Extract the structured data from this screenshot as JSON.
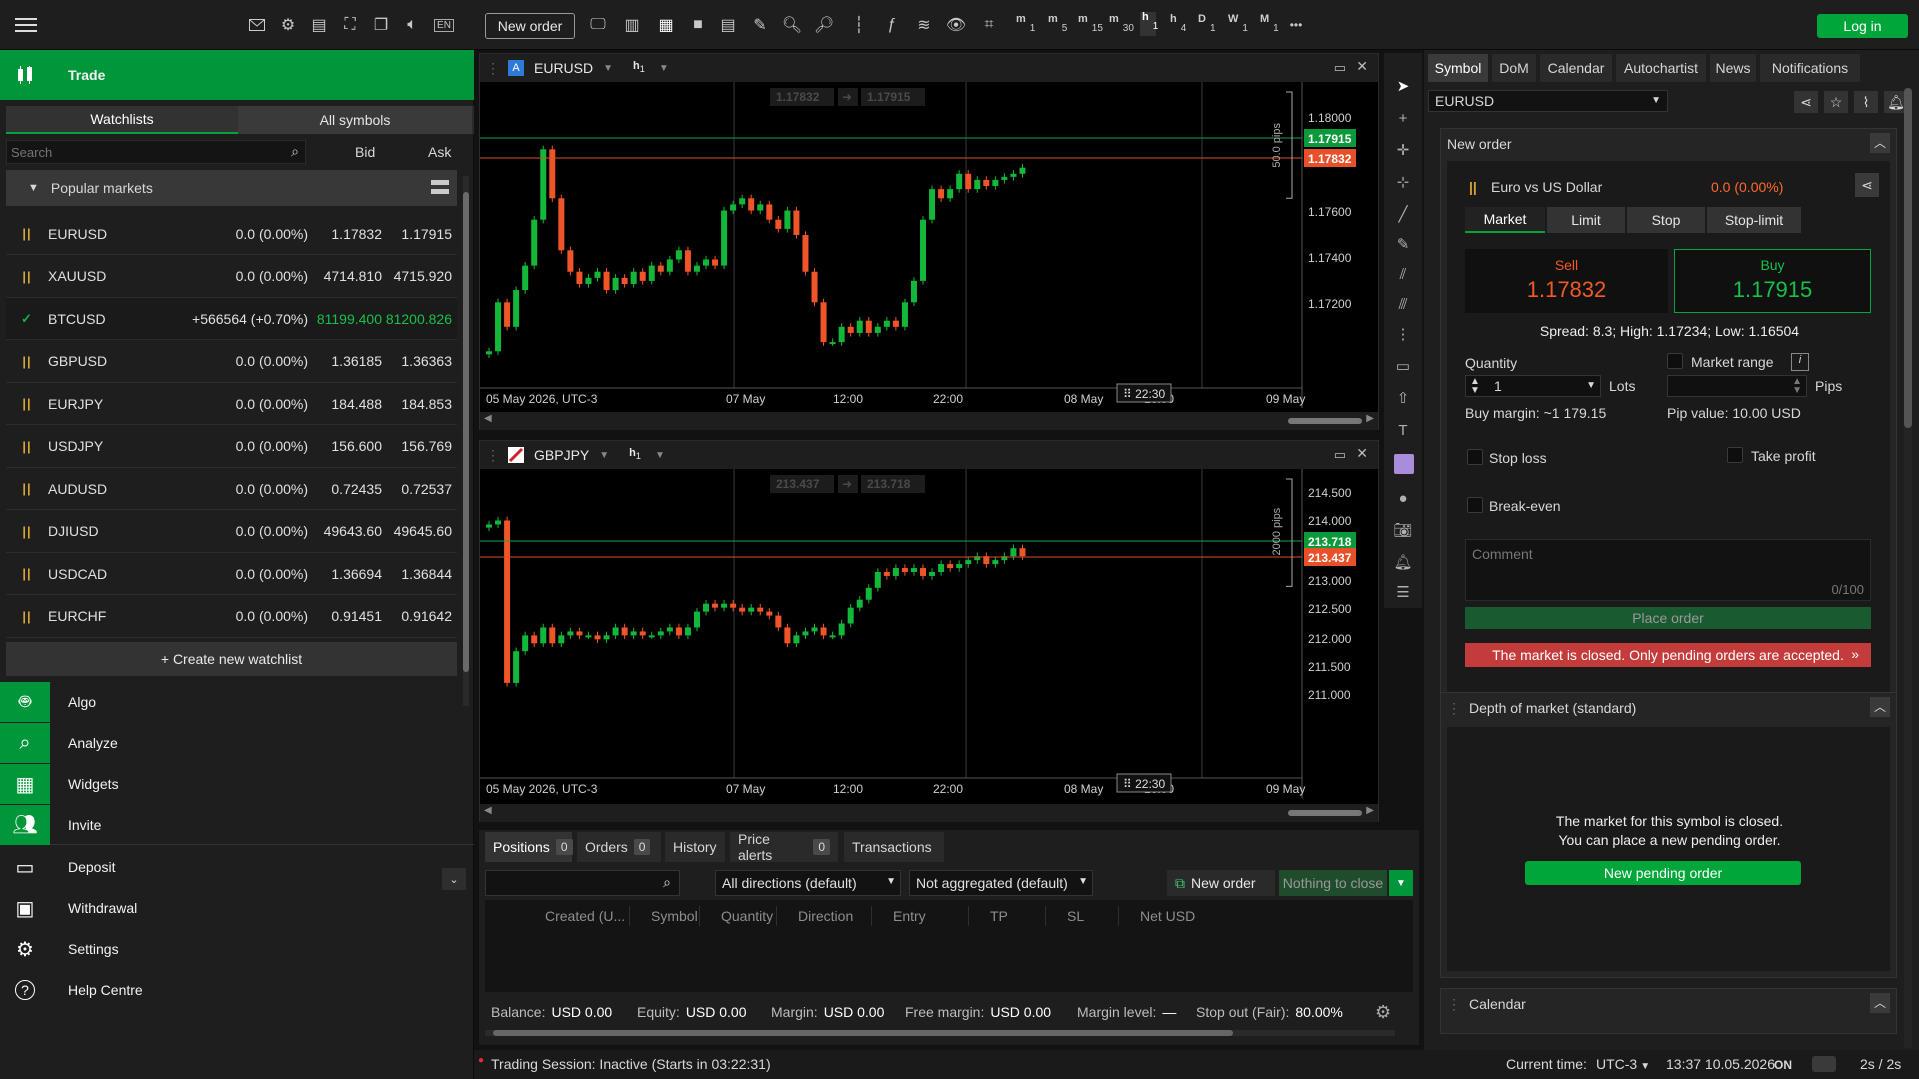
{
  "topbar": {
    "new_order": "New order",
    "login": "Log in",
    "lang": "EN",
    "more": "•••",
    "timeframes": [
      {
        "main": "m",
        "sub": "1"
      },
      {
        "main": "m",
        "sub": "5"
      },
      {
        "main": "m",
        "sub": "15"
      },
      {
        "main": "m",
        "sub": "30"
      },
      {
        "main": "h",
        "sub": "1"
      },
      {
        "main": "h",
        "sub": "4"
      },
      {
        "main": "D",
        "sub": "1"
      },
      {
        "main": "W",
        "sub": "1"
      },
      {
        "main": "M",
        "sub": "1"
      }
    ]
  },
  "sidebar": {
    "trade": "Trade",
    "tabs": [
      "Watchlists",
      "All symbols"
    ],
    "search_placeholder": "Search",
    "col_bid": "Bid",
    "col_ask": "Ask",
    "group": "Popular markets",
    "rows": [
      {
        "sym": "EURUSD",
        "chg": "0.0 (0.00%)",
        "bid": "1.17832",
        "ask": "1.17915",
        "status": "paused"
      },
      {
        "sym": "XAUUSD",
        "chg": "0.0 (0.00%)",
        "bid": "4714.810",
        "ask": "4715.920",
        "status": "paused"
      },
      {
        "sym": "BTCUSD",
        "chg": "+566564 (+0.70%)",
        "bid": "81199.400",
        "ask": "81200.826",
        "status": "open"
      },
      {
        "sym": "GBPUSD",
        "chg": "0.0 (0.00%)",
        "bid": "1.36185",
        "ask": "1.36363",
        "status": "paused"
      },
      {
        "sym": "EURJPY",
        "chg": "0.0 (0.00%)",
        "bid": "184.488",
        "ask": "184.853",
        "status": "paused"
      },
      {
        "sym": "USDJPY",
        "chg": "0.0 (0.00%)",
        "bid": "156.600",
        "ask": "156.769",
        "status": "paused"
      },
      {
        "sym": "AUDUSD",
        "chg": "0.0 (0.00%)",
        "bid": "0.72435",
        "ask": "0.72537",
        "status": "paused"
      },
      {
        "sym": "DJIUSD",
        "chg": "0.0 (0.00%)",
        "bid": "49643.60",
        "ask": "49645.60",
        "status": "paused"
      },
      {
        "sym": "USDCAD",
        "chg": "0.0 (0.00%)",
        "bid": "1.36694",
        "ask": "1.36844",
        "status": "paused"
      },
      {
        "sym": "EURCHF",
        "chg": "0.0 (0.00%)",
        "bid": "0.91451",
        "ask": "0.91642",
        "status": "paused"
      }
    ],
    "create_watchlist": "+ Create new watchlist",
    "nav": [
      "Algo",
      "Analyze",
      "Widgets",
      "Invite",
      "Deposit",
      "Withdrawal",
      "Settings",
      "Help Centre"
    ]
  },
  "chart1": {
    "symbol": "EURUSD",
    "tf": "h",
    "tf_sub": "1",
    "bid_box": "1.17832",
    "ask_box": "1.17915",
    "pips": "50.0 pips",
    "ask_tag": "1.17915",
    "bid_tag": "1.17832",
    "yticks": [
      "1.18000",
      "1.17600",
      "1.17400",
      "1.17200"
    ],
    "xticks": [
      "05 May 2026, UTC-3",
      "07 May",
      "12:00",
      "22:00",
      "08 May",
      "16:00",
      "09 May"
    ],
    "time_tag": "22:30"
  },
  "chart2": {
    "symbol": "GBPJPY",
    "tf": "h",
    "tf_sub": "1",
    "bid_box": "213.437",
    "ask_box": "213.718",
    "pips": "2000 pips",
    "ask_tag": "213.718",
    "bid_tag": "213.437",
    "yticks": [
      "214.500",
      "214.000",
      "213.000",
      "212.500",
      "212.000",
      "211.500",
      "211.000"
    ],
    "xticks": [
      "05 May 2026, UTC-3",
      "07 May",
      "12:00",
      "22:00",
      "08 May",
      "16:00",
      "09 May"
    ],
    "time_tag": "22:30"
  },
  "chart_data": [
    {
      "type": "candlestick",
      "symbol": "EURUSD",
      "ylim": [
        1.171,
        1.181
      ],
      "closes": [
        1.1722,
        1.1738,
        1.173,
        1.1742,
        1.175,
        1.1765,
        1.1788,
        1.1772,
        1.1755,
        1.1748,
        1.1744,
        1.1746,
        1.1748,
        1.1742,
        1.1746,
        1.1744,
        1.1748,
        1.1745,
        1.175,
        1.1748,
        1.1752,
        1.1755,
        1.1748,
        1.175,
        1.1752,
        1.175,
        1.1768,
        1.177,
        1.1772,
        1.1768,
        1.177,
        1.1765,
        1.1762,
        1.1768,
        1.176,
        1.1748,
        1.1738,
        1.1725,
        1.1725,
        1.173,
        1.1728,
        1.1732,
        1.1728,
        1.173,
        1.1732,
        1.173,
        1.1738,
        1.1745,
        1.1765,
        1.1775,
        1.1772,
        1.1775,
        1.178,
        1.1775,
        1.1778,
        1.1776,
        1.1778,
        1.1779,
        1.178,
        1.1782
      ]
    },
    {
      "type": "candlestick",
      "symbol": "GBPJPY",
      "ylim": [
        210.8,
        214.7
      ],
      "closes": [
        214.0,
        214.05,
        212.0,
        212.4,
        212.6,
        212.5,
        212.7,
        212.5,
        212.6,
        212.65,
        212.6,
        212.6,
        212.55,
        212.6,
        212.7,
        212.6,
        212.65,
        212.6,
        212.6,
        212.65,
        212.7,
        212.6,
        212.7,
        212.9,
        213.0,
        212.95,
        213.0,
        212.95,
        212.9,
        212.95,
        212.9,
        212.85,
        212.7,
        212.5,
        212.6,
        212.65,
        212.7,
        212.6,
        212.6,
        212.75,
        212.95,
        213.05,
        213.2,
        213.4,
        213.35,
        213.45,
        213.4,
        213.45,
        213.35,
        213.4,
        213.5,
        213.45,
        213.5,
        213.55,
        213.6,
        213.5,
        213.55,
        213.6,
        213.7,
        213.6
      ]
    }
  ],
  "bottom": {
    "tabs": [
      {
        "label": "Positions",
        "count": "0"
      },
      {
        "label": "Orders",
        "count": "0"
      },
      {
        "label": "History",
        "count": ""
      },
      {
        "label": "Price alerts",
        "count": "0"
      },
      {
        "label": "Transactions",
        "count": ""
      }
    ],
    "dir_select": "All directions (default)",
    "agg_select": "Not aggregated (default)",
    "new_order": "New order",
    "nothing_close": "Nothing to close",
    "columns": [
      "Created (U...",
      "Symbol",
      "Quantity",
      "Direction",
      "Entry",
      "TP",
      "SL",
      "Net USD"
    ],
    "summary": [
      {
        "label": "Balance:",
        "value": "USD 0.00"
      },
      {
        "label": "Equity:",
        "value": "USD 0.00"
      },
      {
        "label": "Margin:",
        "value": "USD 0.00"
      },
      {
        "label": "Free margin:",
        "value": "USD 0.00"
      },
      {
        "label": "Margin level:",
        "value": "—"
      },
      {
        "label": "Stop out (Fair):",
        "value": "80.00%"
      }
    ]
  },
  "status": {
    "session": "Trading Session: Inactive (Starts in 03:22:31)",
    "current_time_label": "Current time:",
    "tz": "UTC-3",
    "time": "13:37 10.05.2026",
    "on": "ON",
    "refresh": "2s / 2s"
  },
  "right": {
    "tabs": [
      "Symbol",
      "DoM",
      "Calendar",
      "Autochartist",
      "News",
      "Notifications"
    ],
    "symbol": "EURUSD",
    "new_order_title": "New order",
    "instrument": "Euro vs US Dollar",
    "instrument_chg": "0.0 (0.00%)",
    "order_types": [
      "Market",
      "Limit",
      "Stop",
      "Stop-limit"
    ],
    "sell_label": "Sell",
    "sell_price": "1.17832",
    "buy_label": "Buy",
    "buy_price": "1.17915",
    "spread_info": "Spread: 8.3; High: 1.17234; Low: 1.16504",
    "quantity_label": "Quantity",
    "quantity_value": "1",
    "lots": "Lots",
    "market_range": "Market range",
    "pips": "Pips",
    "buy_margin": "Buy margin: ~1 179.15",
    "pip_value": "Pip value: 10.00 USD",
    "stop_loss": "Stop loss",
    "take_profit": "Take profit",
    "break_even": "Break-even",
    "comment_placeholder": "Comment",
    "comment_count": "0/100",
    "place_order": "Place order",
    "market_closed": "The market is closed. Only pending orders are accepted.",
    "dom_title": "Depth of market (standard)",
    "dom_msg1": "The market for this symbol is closed.",
    "dom_msg2": "You can place a new pending order.",
    "new_pending": "New pending order",
    "calendar_title": "Calendar"
  },
  "colors": {
    "green": "#00a63a",
    "red": "#f05a24",
    "accent": "#00963a",
    "bull": "#13b83a",
    "bear": "#f0552a"
  }
}
